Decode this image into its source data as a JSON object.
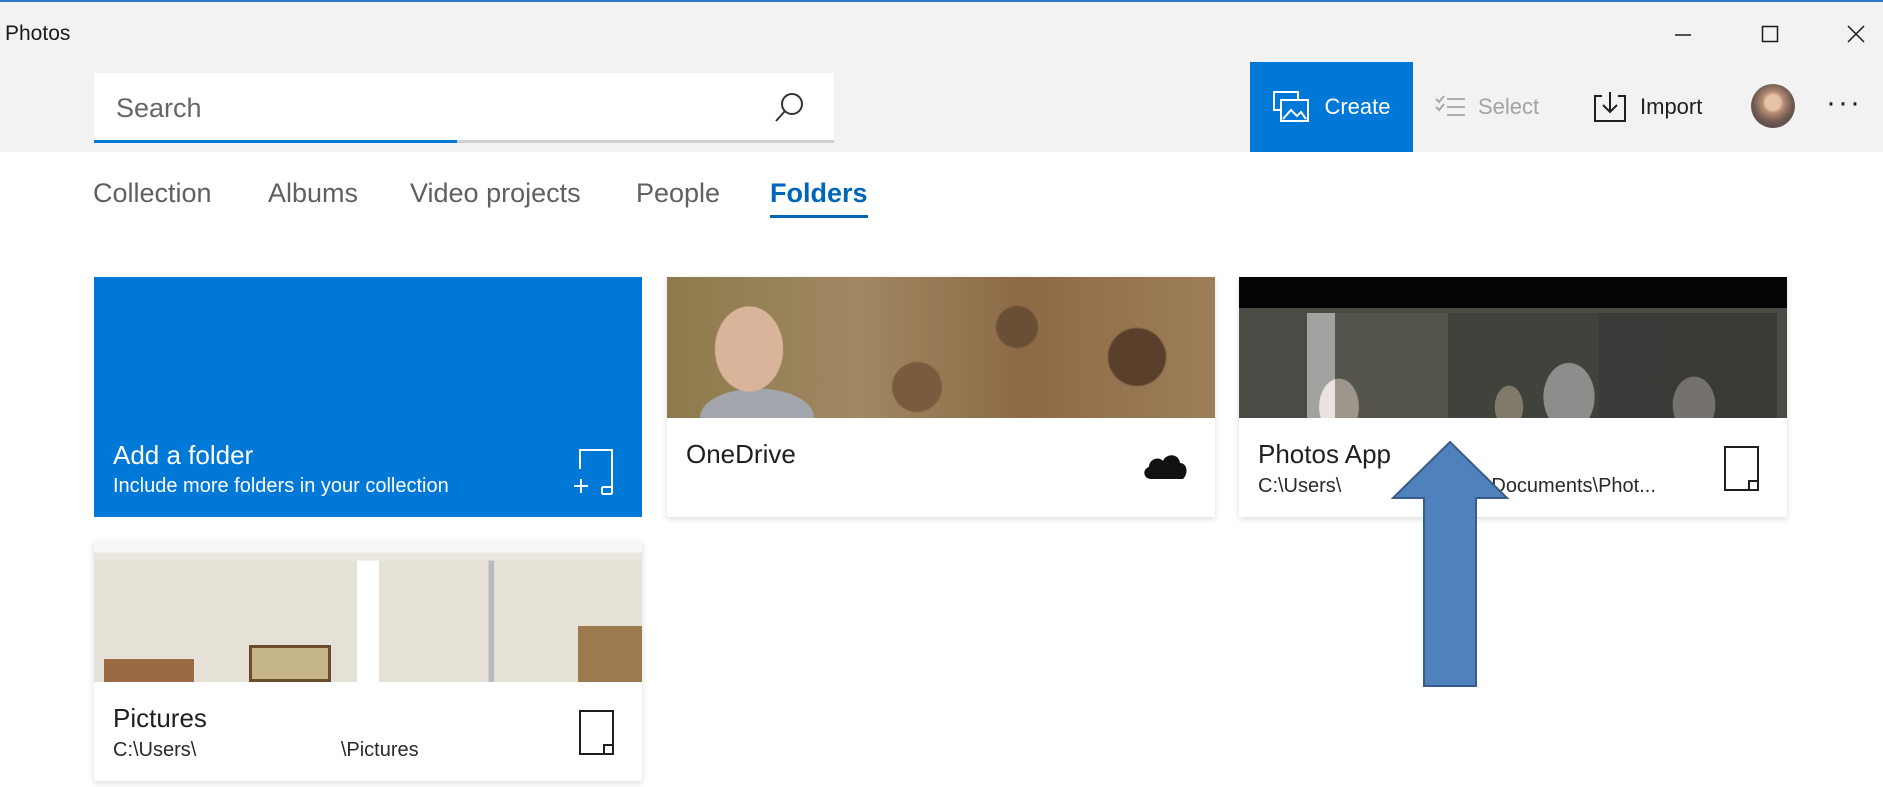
{
  "window": {
    "title": "Photos",
    "controls": {
      "minimize": "—",
      "maximize": "☐",
      "close": "✕"
    }
  },
  "search": {
    "placeholder": "Search",
    "progress": 0.49
  },
  "toolbar": {
    "create_label": "Create",
    "select_label": "Select",
    "import_label": "Import",
    "more_label": "···"
  },
  "tabs": [
    {
      "label": "Collection",
      "active": false
    },
    {
      "label": "Albums",
      "active": false
    },
    {
      "label": "Video projects",
      "active": false
    },
    {
      "label": "People",
      "active": false
    },
    {
      "label": "Folders",
      "active": true
    }
  ],
  "folders": {
    "add": {
      "title": "Add a folder",
      "subtitle": "Include more folders in your collection",
      "icon": "add-folder-icon"
    },
    "items": [
      {
        "name": "OneDrive",
        "path": "",
        "icon": "cloud-icon"
      },
      {
        "name": "Photos App",
        "path": "C:\\Users\\                          \\Documents\\Phot...",
        "icon": "local-folder-icon"
      },
      {
        "name": "Pictures",
        "path": "C:\\Users\\                          \\Pictures",
        "icon": "local-folder-icon"
      }
    ]
  },
  "colors": {
    "accent": "#0078d7",
    "titlebar": "#f2f2f2",
    "arrow": "#4f81bd",
    "arrow_border": "#385d8a"
  }
}
